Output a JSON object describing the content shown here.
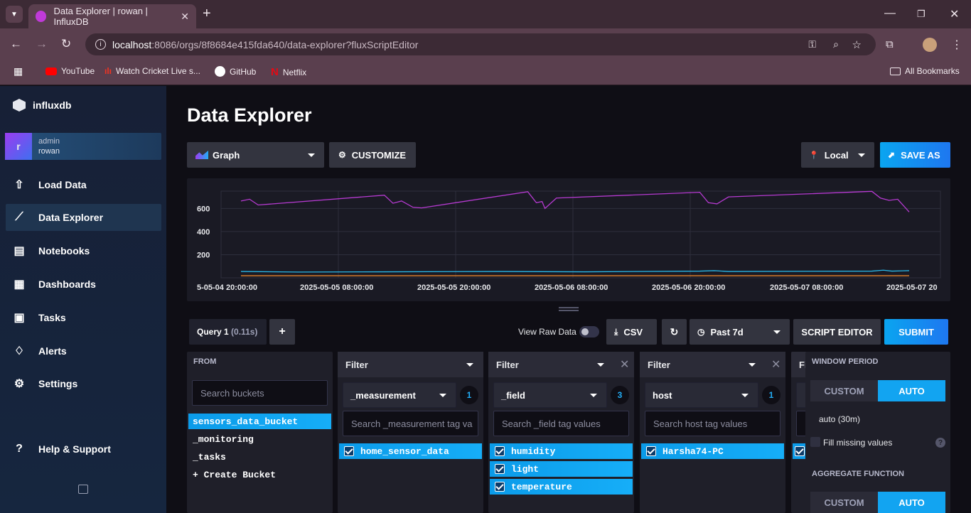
{
  "browser": {
    "tab_title": "Data Explorer | rowan | InfluxDB",
    "url_host": "localhost",
    "url_rest": ":8086/orgs/8f8684e415fda640/data-explorer?fluxScriptEditor",
    "bookmarks": [
      {
        "label": "YouTube",
        "icon": "youtube-icon"
      },
      {
        "label": "Watch Cricket Live s...",
        "icon": "cricket-icon"
      },
      {
        "label": "GitHub",
        "icon": "github-icon"
      },
      {
        "label": "Netflix",
        "icon": "netflix-icon"
      }
    ],
    "all_bookmarks": "All Bookmarks"
  },
  "sidebar": {
    "logo": "influxdb",
    "user": {
      "initial": "r",
      "role": "admin",
      "name": "rowan"
    },
    "items": [
      {
        "label": "Load Data",
        "icon": "upload-icon"
      },
      {
        "label": "Data Explorer",
        "icon": "graph-icon",
        "active": true
      },
      {
        "label": "Notebooks",
        "icon": "notebook-icon"
      },
      {
        "label": "Dashboards",
        "icon": "dashboard-icon"
      },
      {
        "label": "Tasks",
        "icon": "calendar-icon"
      },
      {
        "label": "Alerts",
        "icon": "bell-icon"
      },
      {
        "label": "Settings",
        "icon": "gear-icon"
      }
    ],
    "help": "Help & Support"
  },
  "page": {
    "title": "Data Explorer",
    "vis_type": "Graph",
    "customize": "CUSTOMIZE",
    "timezone": "Local",
    "save_as": "SAVE AS"
  },
  "chart_data": {
    "type": "line",
    "x_ticks": [
      "5-05-04 20:00:00",
      "2025-05-05 08:00:00",
      "2025-05-05 20:00:00",
      "2025-05-06 08:00:00",
      "2025-05-06 20:00:00",
      "2025-05-07 08:00:00",
      "2025-05-07 20"
    ],
    "y_ticks": [
      "600",
      "400",
      "200"
    ],
    "ylim": [
      0,
      750
    ],
    "series": [
      {
        "color": "#b63ad1",
        "points": [
          [
            0.0,
            665
          ],
          [
            0.03,
            680
          ],
          [
            0.06,
            630
          ],
          [
            0.5,
            715
          ],
          [
            0.53,
            645
          ],
          [
            0.56,
            665
          ],
          [
            0.6,
            610
          ],
          [
            0.63,
            605
          ],
          [
            1.0,
            745
          ],
          [
            1.03,
            650
          ],
          [
            1.05,
            660
          ],
          [
            1.06,
            600
          ],
          [
            1.1,
            690
          ],
          [
            1.6,
            740
          ],
          [
            1.63,
            650
          ],
          [
            1.66,
            640
          ],
          [
            1.7,
            700
          ],
          [
            2.2,
            748
          ],
          [
            2.23,
            690
          ],
          [
            2.26,
            670
          ],
          [
            2.29,
            680
          ],
          [
            2.33,
            570
          ]
        ]
      },
      {
        "color": "#28b8e8",
        "points": [
          [
            0.0,
            55
          ],
          [
            0.2,
            50
          ],
          [
            0.5,
            52
          ],
          [
            0.9,
            55
          ],
          [
            1.2,
            52
          ],
          [
            1.6,
            58
          ],
          [
            1.65,
            62
          ],
          [
            1.7,
            55
          ],
          [
            2.2,
            58
          ],
          [
            2.24,
            66
          ],
          [
            2.27,
            58
          ],
          [
            2.33,
            62
          ]
        ]
      },
      {
        "color": "#e8852a",
        "points": [
          [
            0.0,
            18
          ],
          [
            2.33,
            18
          ]
        ]
      }
    ]
  },
  "query": {
    "tab": "Query 1",
    "timing": "(0.11s)",
    "add": "+",
    "view_raw": "View Raw Data",
    "csv": "CSV",
    "range": "Past 7d",
    "script_editor": "SCRIPT EDITOR",
    "submit": "SUBMIT"
  },
  "from": {
    "title": "FROM",
    "placeholder": "Search buckets",
    "buckets": [
      "sensors_data_bucket",
      "_monitoring",
      "_tasks",
      "+ Create Bucket"
    ]
  },
  "filters": [
    {
      "title": "Filter",
      "key": "_measurement",
      "count": "1",
      "placeholder": "Search _measurement tag va",
      "values": [
        "home_sensor_data"
      ]
    },
    {
      "title": "Filter",
      "key": "_field",
      "count": "3",
      "placeholder": "Search _field tag values",
      "values": [
        "humidity",
        "light",
        "temperature"
      ]
    },
    {
      "title": "Filter",
      "key": "host",
      "count": "1",
      "placeholder": "Search host tag values",
      "values": [
        "Harsha74-PC"
      ]
    },
    {
      "title": "Fi"
    }
  ],
  "window": {
    "title": "WINDOW PERIOD",
    "custom": "CUSTOM",
    "auto": "AUTO",
    "period": "auto (30m)",
    "fill_missing": "Fill missing values",
    "aggregate_title": "AGGREGATE FUNCTION",
    "agg_custom": "CUSTOM",
    "agg_auto": "AUTO"
  }
}
